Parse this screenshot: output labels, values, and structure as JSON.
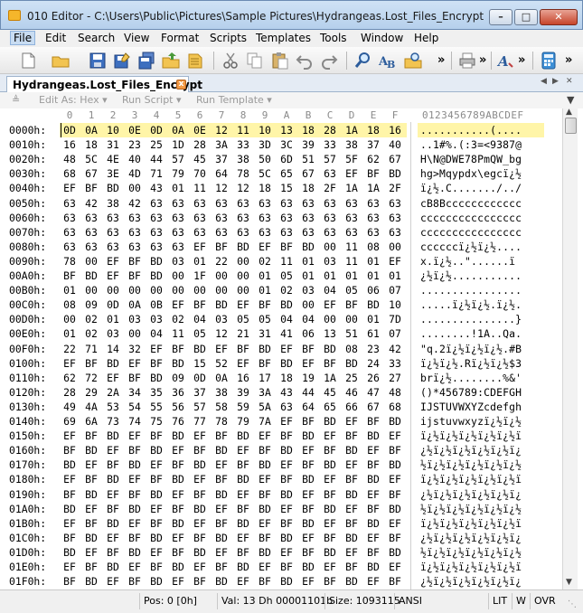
{
  "window": {
    "title": "010 Editor - C:\\Users\\Public\\Pictures\\Sample Pictures\\Hydrangeas.Lost_Files_Encrypt",
    "minimize_glyph": "–",
    "maximize_glyph": "□",
    "close_glyph": "✕"
  },
  "menu": [
    "File",
    "Edit",
    "Search",
    "View",
    "Format",
    "Scripts",
    "Templates",
    "Tools",
    "Window",
    "Help"
  ],
  "toolbar": {
    "icons": [
      "new-file-icon",
      "open-folder-icon",
      "save-icon",
      "save-as-icon",
      "save-all-icon",
      "open-workspace-icon",
      "close-file-icon",
      "cut-icon",
      "copy-icon",
      "paste-icon",
      "undo-icon",
      "redo-icon",
      "find-icon",
      "replace-icon",
      "find-in-files-icon",
      "print-icon",
      "font-icon",
      "calculator-icon"
    ],
    "more_glyph": "»"
  },
  "tab": {
    "label": "Hydrangeas.Lost_Files_Encrypt",
    "close_glyph": "x"
  },
  "editor_bar": {
    "edit_as": "Edit As: Hex ▾",
    "run_script": "Run Script ▾",
    "run_template": "Run Template ▾"
  },
  "ruler": {
    "columns": [
      "0",
      "1",
      "2",
      "3",
      "4",
      "5",
      "6",
      "7",
      "8",
      "9",
      "A",
      "B",
      "C",
      "D",
      "E",
      "F"
    ],
    "ascii": "0123456789ABCDEF"
  },
  "rows": [
    {
      "addr": "0000h:",
      "bytes": [
        "0D",
        "0A",
        "10",
        "0E",
        "0D",
        "0A",
        "0E",
        "12",
        "11",
        "10",
        "13",
        "18",
        "28",
        "1A",
        "18",
        "16"
      ],
      "ascii": "...........(...."
    },
    {
      "addr": "0010h:",
      "bytes": [
        "16",
        "18",
        "31",
        "23",
        "25",
        "1D",
        "28",
        "3A",
        "33",
        "3D",
        "3C",
        "39",
        "33",
        "38",
        "37",
        "40"
      ],
      "ascii": "..1#%.(:3=<9387@"
    },
    {
      "addr": "0020h:",
      "bytes": [
        "48",
        "5C",
        "4E",
        "40",
        "44",
        "57",
        "45",
        "37",
        "38",
        "50",
        "6D",
        "51",
        "57",
        "5F",
        "62",
        "67"
      ],
      "ascii": "H\\N@DWE78PmQW_bg"
    },
    {
      "addr": "0030h:",
      "bytes": [
        "68",
        "67",
        "3E",
        "4D",
        "71",
        "79",
        "70",
        "64",
        "78",
        "5C",
        "65",
        "67",
        "63",
        "EF",
        "BF",
        "BD"
      ],
      "ascii": "hg>Mqypdx\\egcï¿½"
    },
    {
      "addr": "0040h:",
      "bytes": [
        "EF",
        "BF",
        "BD",
        "00",
        "43",
        "01",
        "11",
        "12",
        "12",
        "18",
        "15",
        "18",
        "2F",
        "1A",
        "1A",
        "2F"
      ],
      "ascii": "ï¿½.C......./../"
    },
    {
      "addr": "0050h:",
      "bytes": [
        "63",
        "42",
        "38",
        "42",
        "63",
        "63",
        "63",
        "63",
        "63",
        "63",
        "63",
        "63",
        "63",
        "63",
        "63",
        "63"
      ],
      "ascii": "cB8Bcccccccccccc"
    },
    {
      "addr": "0060h:",
      "bytes": [
        "63",
        "63",
        "63",
        "63",
        "63",
        "63",
        "63",
        "63",
        "63",
        "63",
        "63",
        "63",
        "63",
        "63",
        "63",
        "63"
      ],
      "ascii": "cccccccccccccccc"
    },
    {
      "addr": "0070h:",
      "bytes": [
        "63",
        "63",
        "63",
        "63",
        "63",
        "63",
        "63",
        "63",
        "63",
        "63",
        "63",
        "63",
        "63",
        "63",
        "63",
        "63"
      ],
      "ascii": "cccccccccccccccc"
    },
    {
      "addr": "0080h:",
      "bytes": [
        "63",
        "63",
        "63",
        "63",
        "63",
        "63",
        "EF",
        "BF",
        "BD",
        "EF",
        "BF",
        "BD",
        "00",
        "11",
        "08",
        "00"
      ],
      "ascii": "ccccccï¿½ï¿½...."
    },
    {
      "addr": "0090h:",
      "bytes": [
        "78",
        "00",
        "EF",
        "BF",
        "BD",
        "03",
        "01",
        "22",
        "00",
        "02",
        "11",
        "01",
        "03",
        "11",
        "01",
        "EF"
      ],
      "ascii": "x.ï¿½..\"......ï"
    },
    {
      "addr": "00A0h:",
      "bytes": [
        "BF",
        "BD",
        "EF",
        "BF",
        "BD",
        "00",
        "1F",
        "00",
        "00",
        "01",
        "05",
        "01",
        "01",
        "01",
        "01",
        "01"
      ],
      "ascii": "¿½ï¿½..........."
    },
    {
      "addr": "00B0h:",
      "bytes": [
        "01",
        "00",
        "00",
        "00",
        "00",
        "00",
        "00",
        "00",
        "00",
        "01",
        "02",
        "03",
        "04",
        "05",
        "06",
        "07"
      ],
      "ascii": "................"
    },
    {
      "addr": "00C0h:",
      "bytes": [
        "08",
        "09",
        "0D",
        "0A",
        "0B",
        "EF",
        "BF",
        "BD",
        "EF",
        "BF",
        "BD",
        "00",
        "EF",
        "BF",
        "BD",
        "10"
      ],
      "ascii": ".....ï¿½ï¿½.ï¿½."
    },
    {
      "addr": "00D0h:",
      "bytes": [
        "00",
        "02",
        "01",
        "03",
        "03",
        "02",
        "04",
        "03",
        "05",
        "05",
        "04",
        "04",
        "00",
        "00",
        "01",
        "7D"
      ],
      "ascii": "...............}"
    },
    {
      "addr": "00E0h:",
      "bytes": [
        "01",
        "02",
        "03",
        "00",
        "04",
        "11",
        "05",
        "12",
        "21",
        "31",
        "41",
        "06",
        "13",
        "51",
        "61",
        "07"
      ],
      "ascii": "........!1A..Qa."
    },
    {
      "addr": "00F0h:",
      "bytes": [
        "22",
        "71",
        "14",
        "32",
        "EF",
        "BF",
        "BD",
        "EF",
        "BF",
        "BD",
        "EF",
        "BF",
        "BD",
        "08",
        "23",
        "42"
      ],
      "ascii": "\"q.2ï¿½ï¿½ï¿½.#B"
    },
    {
      "addr": "0100h:",
      "bytes": [
        "EF",
        "BF",
        "BD",
        "EF",
        "BF",
        "BD",
        "15",
        "52",
        "EF",
        "BF",
        "BD",
        "EF",
        "BF",
        "BD",
        "24",
        "33"
      ],
      "ascii": "ï¿½ï¿½.Rï¿½ï¿½$3"
    },
    {
      "addr": "0110h:",
      "bytes": [
        "62",
        "72",
        "EF",
        "BF",
        "BD",
        "09",
        "0D",
        "0A",
        "16",
        "17",
        "18",
        "19",
        "1A",
        "25",
        "26",
        "27"
      ],
      "ascii": "brï¿½........%&'"
    },
    {
      "addr": "0120h:",
      "bytes": [
        "28",
        "29",
        "2A",
        "34",
        "35",
        "36",
        "37",
        "38",
        "39",
        "3A",
        "43",
        "44",
        "45",
        "46",
        "47",
        "48"
      ],
      "ascii": "()*456789:CDEFGH"
    },
    {
      "addr": "0130h:",
      "bytes": [
        "49",
        "4A",
        "53",
        "54",
        "55",
        "56",
        "57",
        "58",
        "59",
        "5A",
        "63",
        "64",
        "65",
        "66",
        "67",
        "68"
      ],
      "ascii": "IJSTUVWXYZcdefgh"
    },
    {
      "addr": "0140h:",
      "bytes": [
        "69",
        "6A",
        "73",
        "74",
        "75",
        "76",
        "77",
        "78",
        "79",
        "7A",
        "EF",
        "BF",
        "BD",
        "EF",
        "BF",
        "BD"
      ],
      "ascii": "ijstuvwxyzï¿½ï¿½"
    },
    {
      "addr": "0150h:",
      "bytes": [
        "EF",
        "BF",
        "BD",
        "EF",
        "BF",
        "BD",
        "EF",
        "BF",
        "BD",
        "EF",
        "BF",
        "BD",
        "EF",
        "BF",
        "BD",
        "EF"
      ],
      "ascii": "ï¿½ï¿½ï¿½ï¿½ï¿½ï"
    },
    {
      "addr": "0160h:",
      "bytes": [
        "BF",
        "BD",
        "EF",
        "BF",
        "BD",
        "EF",
        "BF",
        "BD",
        "EF",
        "BF",
        "BD",
        "EF",
        "BF",
        "BD",
        "EF",
        "BF"
      ],
      "ascii": "¿½ï¿½ï¿½ï¿½ï¿½ï¿"
    },
    {
      "addr": "0170h:",
      "bytes": [
        "BD",
        "EF",
        "BF",
        "BD",
        "EF",
        "BF",
        "BD",
        "EF",
        "BF",
        "BD",
        "EF",
        "BF",
        "BD",
        "EF",
        "BF",
        "BD"
      ],
      "ascii": "½ï¿½ï¿½ï¿½ï¿½ï¿½"
    },
    {
      "addr": "0180h:",
      "bytes": [
        "EF",
        "BF",
        "BD",
        "EF",
        "BF",
        "BD",
        "EF",
        "BF",
        "BD",
        "EF",
        "BF",
        "BD",
        "EF",
        "BF",
        "BD",
        "EF"
      ],
      "ascii": "ï¿½ï¿½ï¿½ï¿½ï¿½ï"
    },
    {
      "addr": "0190h:",
      "bytes": [
        "BF",
        "BD",
        "EF",
        "BF",
        "BD",
        "EF",
        "BF",
        "BD",
        "EF",
        "BF",
        "BD",
        "EF",
        "BF",
        "BD",
        "EF",
        "BF"
      ],
      "ascii": "¿½ï¿½ï¿½ï¿½ï¿½ï¿"
    },
    {
      "addr": "01A0h:",
      "bytes": [
        "BD",
        "EF",
        "BF",
        "BD",
        "EF",
        "BF",
        "BD",
        "EF",
        "BF",
        "BD",
        "EF",
        "BF",
        "BD",
        "EF",
        "BF",
        "BD"
      ],
      "ascii": "½ï¿½ï¿½ï¿½ï¿½ï¿½"
    },
    {
      "addr": "01B0h:",
      "bytes": [
        "EF",
        "BF",
        "BD",
        "EF",
        "BF",
        "BD",
        "EF",
        "BF",
        "BD",
        "EF",
        "BF",
        "BD",
        "EF",
        "BF",
        "BD",
        "EF"
      ],
      "ascii": "ï¿½ï¿½ï¿½ï¿½ï¿½ï"
    },
    {
      "addr": "01C0h:",
      "bytes": [
        "BF",
        "BD",
        "EF",
        "BF",
        "BD",
        "EF",
        "BF",
        "BD",
        "EF",
        "BF",
        "BD",
        "EF",
        "BF",
        "BD",
        "EF",
        "BF"
      ],
      "ascii": "¿½ï¿½ï¿½ï¿½ï¿½ï¿"
    },
    {
      "addr": "01D0h:",
      "bytes": [
        "BD",
        "EF",
        "BF",
        "BD",
        "EF",
        "BF",
        "BD",
        "EF",
        "BF",
        "BD",
        "EF",
        "BF",
        "BD",
        "EF",
        "BF",
        "BD"
      ],
      "ascii": "½ï¿½ï¿½ï¿½ï¿½ï¿½"
    },
    {
      "addr": "01E0h:",
      "bytes": [
        "EF",
        "BF",
        "BD",
        "EF",
        "BF",
        "BD",
        "EF",
        "BF",
        "BD",
        "EF",
        "BF",
        "BD",
        "EF",
        "BF",
        "BD",
        "EF"
      ],
      "ascii": "ï¿½ï¿½ï¿½ï¿½ï¿½ï"
    },
    {
      "addr": "01F0h:",
      "bytes": [
        "BF",
        "BD",
        "EF",
        "BF",
        "BD",
        "EF",
        "BF",
        "BD",
        "EF",
        "BF",
        "BD",
        "EF",
        "BF",
        "BD",
        "EF",
        "BF"
      ],
      "ascii": "¿½ï¿½ï¿½ï¿½ï¿½ï¿"
    }
  ],
  "status": {
    "pos": "Pos: 0 [0h]",
    "val": "Val: 13 Dh 00001101b",
    "size": "Size: 1093115",
    "encoding": "ANSI",
    "endian": "LIT",
    "mode_w": "W",
    "mode_ovr": "OVR"
  },
  "colors": {
    "selection": "#fff5a8",
    "titlebar": "#b6d0ec"
  }
}
